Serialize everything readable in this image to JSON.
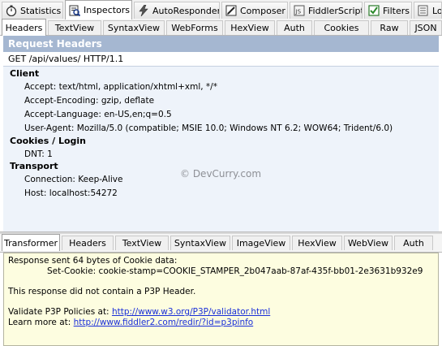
{
  "main_tabs": [
    {
      "label": "Statistics",
      "icon": "stopwatch-icon"
    },
    {
      "label": "Inspectors",
      "icon": "magnifier-icon"
    },
    {
      "label": "AutoResponder",
      "icon": "lightning-icon"
    },
    {
      "label": "Composer",
      "icon": "pencil-icon"
    },
    {
      "label": "FiddlerScript",
      "icon": "script-icon"
    },
    {
      "label": "Filters",
      "icon": "checkbox-icon"
    },
    {
      "label": "Lo",
      "icon": "log-icon"
    }
  ],
  "request_tabs": [
    "Headers",
    "TextView",
    "SyntaxView",
    "WebForms",
    "HexView",
    "Auth",
    "Cookies",
    "Raw",
    "JSON"
  ],
  "request": {
    "section_title": "Request Headers",
    "request_line": "GET /api/values/ HTTP/1.1",
    "groups": [
      {
        "name": "Client",
        "headers": [
          "Accept: text/html, application/xhtml+xml, */*",
          "Accept-Encoding: gzip, deflate",
          "Accept-Language: en-US,en;q=0.5",
          "User-Agent: Mozilla/5.0 (compatible; MSIE 10.0; Windows NT 6.2; WOW64; Trident/6.0)"
        ]
      },
      {
        "name": "Cookies / Login",
        "headers": [
          "DNT: 1"
        ]
      },
      {
        "name": "Transport",
        "headers": [
          "Connection: Keep-Alive",
          "Host: localhost:54272"
        ]
      }
    ]
  },
  "watermark": "© DevCurry.com",
  "response_tabs": [
    "Transformer",
    "Headers",
    "TextView",
    "SyntaxView",
    "ImageView",
    "HexView",
    "WebView",
    "Auth"
  ],
  "response": {
    "line1": "Response sent 64 bytes of Cookie data:",
    "line2": "Set-Cookie: cookie-stamp=COOKIE_STAMPER_2b047aab-87af-435f-bb01-2e3631b932e9",
    "line3": "This response did not contain a P3P Header.",
    "validate_label": "Validate P3P Policies at:",
    "validate_link": "http://www.w3.org/P3P/validator.html",
    "learn_label": "Learn more at:",
    "learn_link": "http://www.fiddler2.com/redir/?id=p3pinfo"
  },
  "colors": {
    "section_header_bg": "#a5b7d1",
    "headers_bg": "#eef3fa",
    "response_bg": "#fdfde0",
    "link": "#1a2fd8"
  }
}
